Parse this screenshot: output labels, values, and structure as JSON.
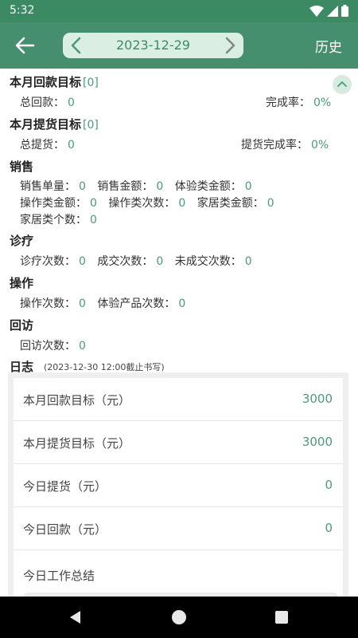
{
  "status_bar": {
    "time": "5:32"
  },
  "header": {
    "date": "2023-12-29",
    "history_label": "历史"
  },
  "sections": {
    "monthly_payment": {
      "title": "本月回款目标",
      "count": "[0]",
      "total_label": "总回款：",
      "total_value": "0",
      "rate_label": "完成率：",
      "rate_value": "0%"
    },
    "monthly_pickup": {
      "title": "本月提货目标",
      "count": "[0]",
      "total_label": "总提货：",
      "total_value": "0",
      "rate_label": "提货完成率：",
      "rate_value": "0%"
    },
    "sales": {
      "title": "销售",
      "items": [
        {
          "label": "销售单量：",
          "value": "0"
        },
        {
          "label": "销售金额：",
          "value": "0"
        },
        {
          "label": "体验类金额：",
          "value": "0"
        },
        {
          "label": "操作类金额：",
          "value": "0"
        },
        {
          "label": "操作类次数：",
          "value": "0"
        },
        {
          "label": "家居类金额：",
          "value": "0"
        },
        {
          "label": "家居类个数：",
          "value": "0"
        }
      ]
    },
    "diagnosis": {
      "title": "诊疗",
      "items": [
        {
          "label": "诊疗次数：",
          "value": "0"
        },
        {
          "label": "成交次数：",
          "value": "0"
        },
        {
          "label": "未成交次数：",
          "value": "0"
        }
      ]
    },
    "operation": {
      "title": "操作",
      "items": [
        {
          "label": "操作次数：",
          "value": "0"
        },
        {
          "label": "体验产品次数：",
          "value": "0"
        }
      ]
    },
    "revisit": {
      "title": "回访",
      "items": [
        {
          "label": "回访次数：",
          "value": "0"
        }
      ]
    }
  },
  "log": {
    "title": "日志",
    "note": "(2023-12-30 12:00截止书写)",
    "items": [
      {
        "label": "本月回款目标（元）",
        "value": "3000"
      },
      {
        "label": "本月提货目标（元）",
        "value": "3000"
      },
      {
        "label": "今日提货（元）",
        "value": "0"
      },
      {
        "label": "今日回款（元）",
        "value": "0"
      }
    ],
    "summary_label": "今日工作总结"
  }
}
